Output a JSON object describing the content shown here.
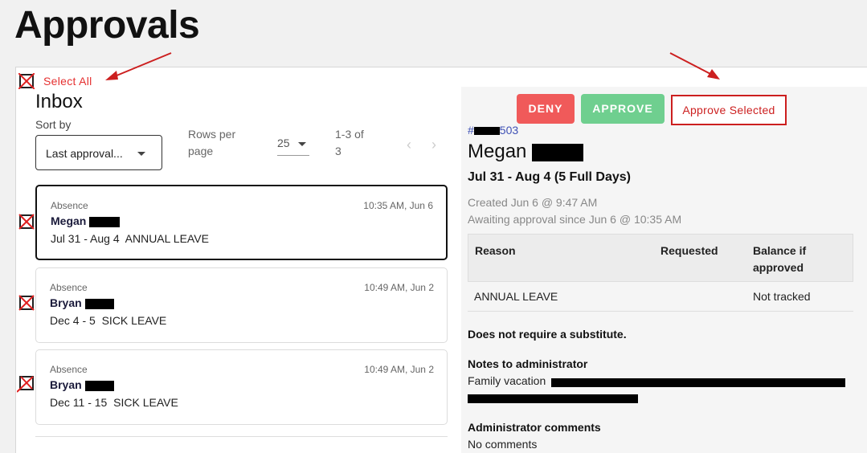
{
  "page_title": "Approvals",
  "inbox": {
    "select_all_label": "Select All",
    "title": "Inbox",
    "sort": {
      "label": "Sort by",
      "value": "Last approval..."
    },
    "rows_per_page": {
      "label": "Rows per page",
      "value": "25"
    },
    "range": "1-3 of 3",
    "prev_icon": "chevron-left-icon",
    "next_icon": "chevron-right-icon",
    "items": [
      {
        "type": "Absence",
        "time": "10:35 AM, Jun 6",
        "name": "Megan",
        "dates": "Jul 31 - Aug 4",
        "leave": "ANNUAL LEAVE",
        "selected": true
      },
      {
        "type": "Absence",
        "time": "10:49 AM, Jun 2",
        "name": "Bryan",
        "dates": "Dec 4 - 5",
        "leave": "SICK LEAVE",
        "selected": false
      },
      {
        "type": "Absence",
        "time": "10:49 AM, Jun 2",
        "name": "Bryan",
        "dates": "Dec 11 - 15",
        "leave": "SICK LEAVE",
        "selected": false
      }
    ]
  },
  "actions": {
    "deny": "DENY",
    "approve": "APPROVE",
    "approve_selected": "Approve Selected"
  },
  "detail": {
    "id_prefix": "#",
    "id_suffix": "503",
    "name": "Megan",
    "range": "Jul 31 - Aug 4 (5 Full Days)",
    "created": "Created Jun 6 @ 9:47 AM",
    "awaiting": "Awaiting approval since Jun 6 @ 10:35 AM",
    "table": {
      "headers": [
        "Reason",
        "Requested",
        "Balance if approved"
      ],
      "rows": [
        [
          "ANNUAL LEAVE",
          "",
          "Not tracked"
        ]
      ]
    },
    "substitute": "Does not require a substitute.",
    "notes_label": "Notes to administrator",
    "notes_text": "Family vacation",
    "admin_comments_label": "Administrator comments",
    "admin_comments": "No comments"
  },
  "colors": {
    "deny": "#f05a5a",
    "approve": "#6fcf8f",
    "annotation": "#cc1f1f",
    "link": "#3f51b5"
  }
}
